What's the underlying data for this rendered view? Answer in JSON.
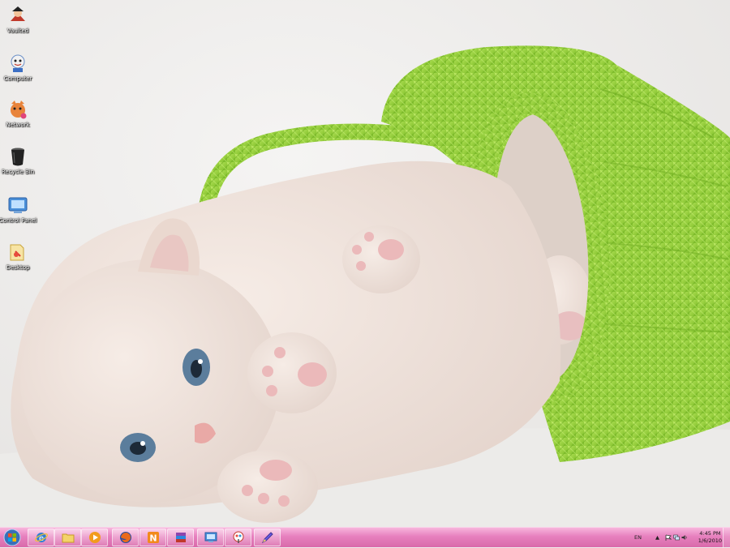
{
  "desktop": {
    "icons": [
      {
        "label": "Vaulted",
        "icon": "user-folder-icon"
      },
      {
        "label": "Computer",
        "icon": "computer-icon"
      },
      {
        "label": "Network",
        "icon": "network-icon"
      },
      {
        "label": "Recycle Bin",
        "icon": "recycle-bin-icon"
      },
      {
        "label": "Control Panel",
        "icon": "control-panel-icon"
      },
      {
        "label": "Desktop",
        "icon": "desktop-folder-icon"
      }
    ]
  },
  "taskbar": {
    "pinned": [
      {
        "name": "internet-explorer",
        "icon": "ie-icon"
      },
      {
        "name": "windows-explorer",
        "icon": "folder-icon"
      },
      {
        "name": "media-player",
        "icon": "media-player-icon"
      },
      {
        "name": "firefox",
        "icon": "firefox-icon"
      },
      {
        "name": "n-app",
        "icon": "n-app-icon",
        "letter": "N"
      },
      {
        "name": "winrar",
        "icon": "winrar-icon"
      },
      {
        "name": "remote-desktop",
        "icon": "remote-desktop-icon"
      },
      {
        "name": "paint",
        "icon": "paint-icon"
      },
      {
        "name": "editor",
        "icon": "pen-icon"
      }
    ],
    "tray": {
      "language": "EN",
      "time": "4:45 PM",
      "date": "1/6/2010"
    }
  },
  "colors": {
    "taskbar": "#e780be",
    "basket": "#9bd63a",
    "background": "#eeeceb"
  }
}
